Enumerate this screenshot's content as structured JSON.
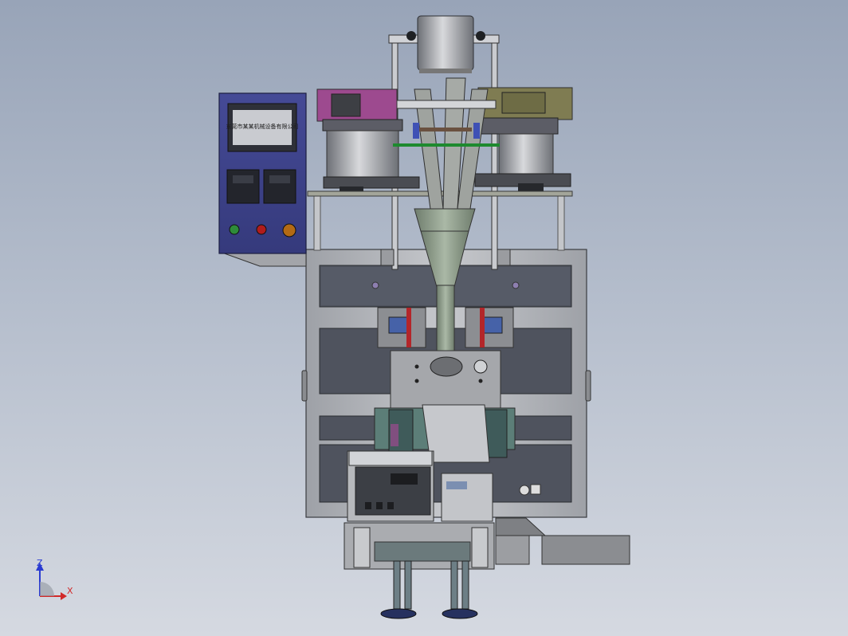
{
  "view": {
    "axis_x_label": "X",
    "axis_z_label": "Z"
  },
  "hmi_panel": {
    "screen_text": "东莞市某某机械设备有限公司",
    "bottom_buttons": [
      {
        "name": "start-button",
        "color": "#2e8b3a"
      },
      {
        "name": "stop-button",
        "color": "#b01c1c"
      },
      {
        "name": "aux-button",
        "color": "#b36a14"
      }
    ]
  },
  "colors": {
    "frame": "#b5b7bc",
    "frame_dark": "#6f7278",
    "cabinet": "#3b3f86",
    "bowl_left": "#9d4a8f",
    "bowl_right": "#7f7c52",
    "funnel": "#8b9a88",
    "guide_bar": "#1e8a2f"
  }
}
